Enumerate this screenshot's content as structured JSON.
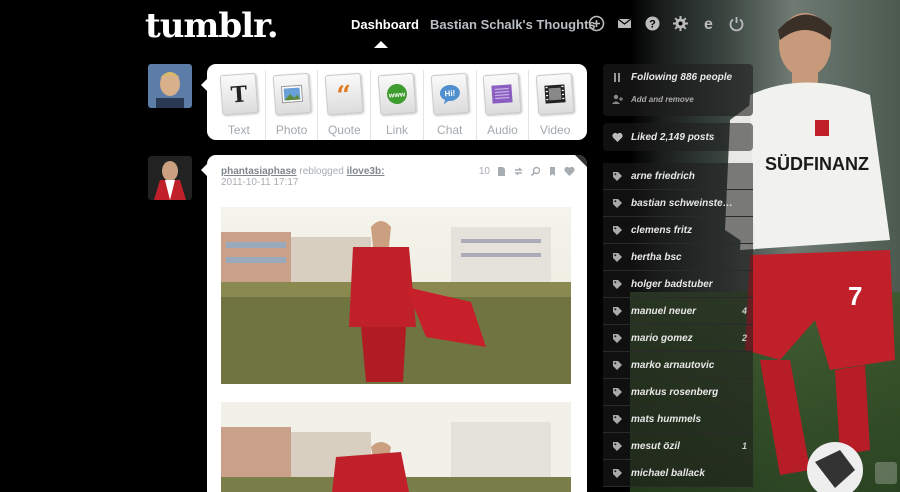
{
  "header": {
    "logo": "tumblr.",
    "nav_dashboard": "Dashboard",
    "nav_blog": "Bastian Schalk's Thoughts",
    "icons": [
      "plus-circle-icon",
      "mail-icon",
      "help-icon",
      "gear-icon",
      "e-icon",
      "power-icon"
    ]
  },
  "post_types": [
    {
      "label": "Text",
      "icon": "text-icon"
    },
    {
      "label": "Photo",
      "icon": "photo-icon"
    },
    {
      "label": "Quote",
      "icon": "quote-icon"
    },
    {
      "label": "Link",
      "icon": "link-icon"
    },
    {
      "label": "Chat",
      "icon": "chat-icon"
    },
    {
      "label": "Audio",
      "icon": "audio-icon"
    },
    {
      "label": "Video",
      "icon": "video-icon"
    }
  ],
  "post": {
    "user": "phantasiaphase",
    "action": "reblogged",
    "source": "ilove3b:",
    "date": "2011-10-11 17:17",
    "notes": "10"
  },
  "sidebar": {
    "following": "Following 886 people",
    "add_remove": "Add and remove",
    "liked": "Liked 2,149 posts",
    "tags": [
      {
        "label": "arne friedrich",
        "count": ""
      },
      {
        "label": "bastian schweinsteiger",
        "count": ""
      },
      {
        "label": "clemens fritz",
        "count": ""
      },
      {
        "label": "hertha bsc",
        "count": ""
      },
      {
        "label": "holger badstuber",
        "count": ""
      },
      {
        "label": "manuel neuer",
        "count": "4"
      },
      {
        "label": "mario gomez",
        "count": "2"
      },
      {
        "label": "marko arnautovic",
        "count": ""
      },
      {
        "label": "markus rosenberg",
        "count": ""
      },
      {
        "label": "mats hummels",
        "count": ""
      },
      {
        "label": "mesut özil",
        "count": "1"
      },
      {
        "label": "michael ballack",
        "count": ""
      }
    ]
  },
  "colors": {
    "bg": "#000000",
    "nav_inactive": "#b9bec3",
    "meta": "#a8adb2",
    "jersey_red": "#c0202a"
  }
}
